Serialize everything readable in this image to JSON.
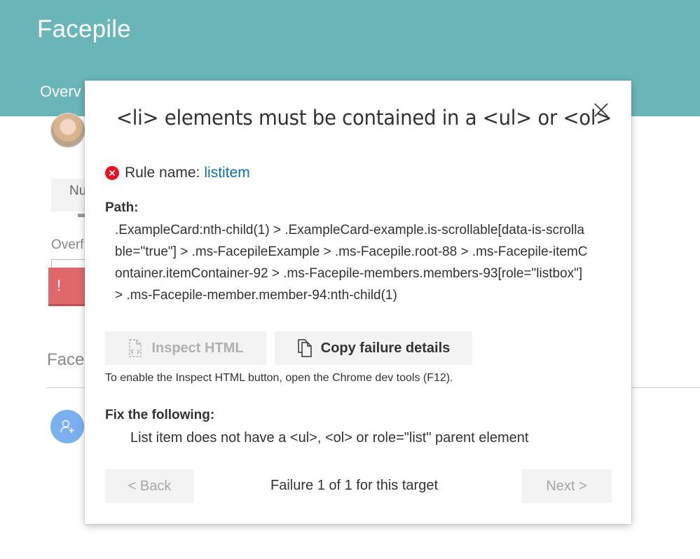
{
  "background": {
    "title": "Facepile",
    "tab_label": "Overv",
    "slider_label": "Nu",
    "overflow_label": "Overf",
    "error_badge": "!",
    "section_title": "Facep",
    "header_color": "#69b5b7"
  },
  "modal": {
    "title": "<li> elements must be contained in a <ul> or <ol>",
    "close_icon": "close-icon",
    "rule_label": "Rule name:",
    "rule_name": "listitem",
    "path_label": "Path:",
    "path_value": ".ExampleCard:nth-child(1) > .ExampleCard-example.is-scrollable[data-is-scrollable=\"true\"] > .ms-FacepileExample > .ms-Facepile.root-88 > .ms-Facepile-itemContainer.itemContainer-92 > .ms-Facepile-members.members-93[role=\"listbox\"] > .ms-Facepile-member.member-94:nth-child(1)",
    "inspect_button": "Inspect HTML",
    "copy_button": "Copy failure details",
    "enable_note": "To enable the Inspect HTML button, open the Chrome dev tools (F12).",
    "fix_label": "Fix the following:",
    "fix_item": "List item does not have a <ul>, <ol> or role=\"list\" parent element",
    "back_button": "< Back",
    "failure_count": "Failure 1 of 1 for this target",
    "next_button": "Next >",
    "error_color": "#e81123",
    "link_color": "#106ebe"
  }
}
